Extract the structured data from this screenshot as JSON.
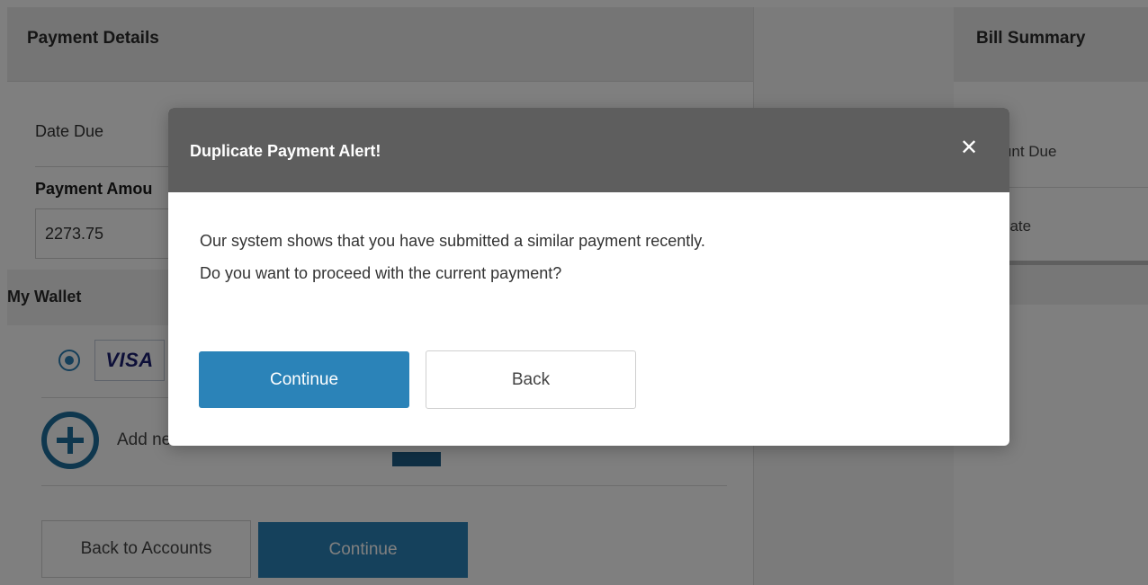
{
  "payment_details": {
    "title": "Payment Details",
    "date_due_label": "Date Due",
    "amount_label": "Payment Amou",
    "amount_value": "2273.75",
    "wallet_title": "My Wallet",
    "card_brand": "VISA",
    "add_label": "Add ne",
    "back_to_accounts": "Back to Accounts",
    "continue": "Continue"
  },
  "bill_summary": {
    "title": "Bill Summary",
    "amount_due_label": "nount Due",
    "due_date_label": "e Date"
  },
  "modal": {
    "title": "Duplicate Payment Alert!",
    "close_glyph": "✕",
    "message_line1": "Our system shows that you have submitted a similar payment recently.",
    "message_line2": "Do you want to proceed with the current payment?",
    "continue": "Continue",
    "back": "Back"
  },
  "colors": {
    "primary": "#2b83b8",
    "icon_blue": "#1f6f9c",
    "modal_header": "#5e5e5e",
    "overlay": "rgba(0,0,0,0.5)"
  }
}
